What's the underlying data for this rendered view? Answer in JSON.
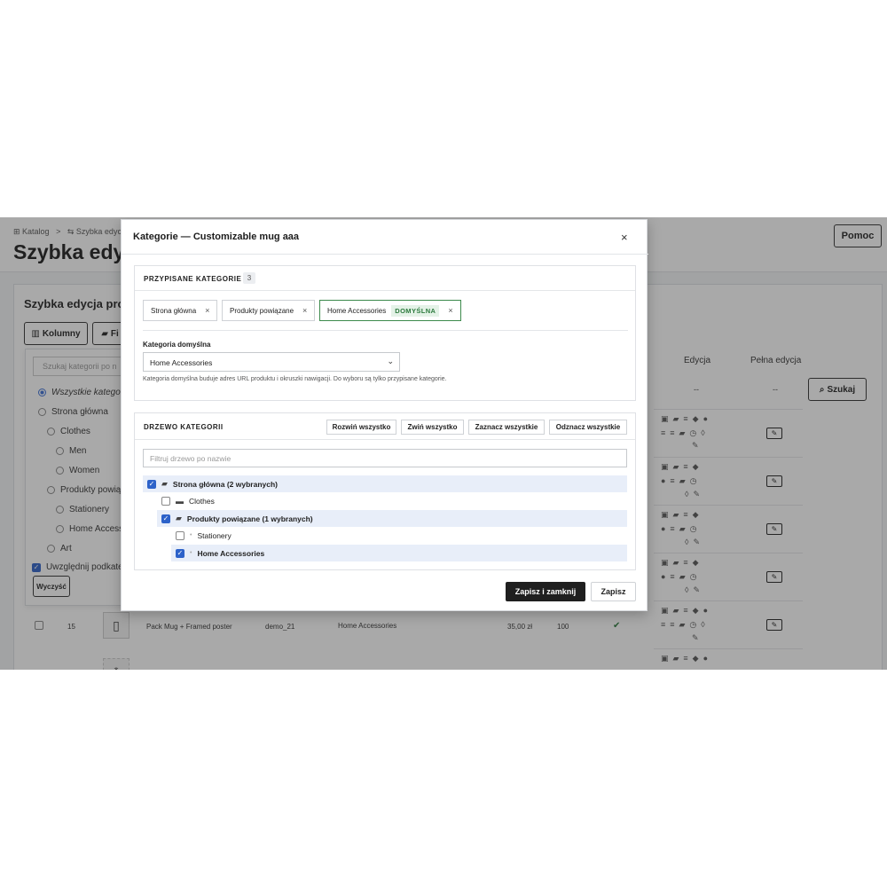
{
  "breadcrumb": {
    "root": "⊞ Katalog",
    "sep": ">",
    "current": "⇆ Szybka edycja"
  },
  "page": {
    "title": "Szybka edycja",
    "help_label": "Pomoc"
  },
  "card": {
    "title": "Szybka edycja prod",
    "columns_label": "Kolumny",
    "filter_label": "Fi",
    "search_label": "Szukaj"
  },
  "filter_panel": {
    "search_placeholder": "Szukaj kategorii po n",
    "items": [
      "Wszystkie kategor",
      "Strona główna",
      "Clothes",
      "Men",
      "Women",
      "Produkty powią",
      "Stationery",
      "Home Access",
      "Art"
    ],
    "include_sub": "Uwzględnij podkate",
    "clear": "Wyczyść"
  },
  "table": {
    "col_edit": "Edycja",
    "col_full_edit": "Pełna edycja",
    "dash": "--",
    "row": {
      "id": "15",
      "name": "Pack Mug + Framed poster",
      "ref": "demo_21",
      "category": "Home Accessories",
      "price": "35,00 zł",
      "qty": "100"
    }
  },
  "modal": {
    "title": "Kategorie — Customizable mug aaa",
    "close": "×",
    "assigned": {
      "title": "PRZYPISANE KATEGORIE",
      "count": "3",
      "tags": [
        {
          "label": "Strona główna"
        },
        {
          "label": "Produkty powiązane"
        },
        {
          "label": "Home Accessories",
          "badge": "DOMYŚLNA"
        }
      ],
      "default_label": "Kategoria domyślna",
      "default_value": "Home Accessories",
      "help": "Kategoria domyślna buduje adres URL produktu i okruszki nawigacji. Do wyboru są tylko przypisane kategorie."
    },
    "tree": {
      "title": "DRZEWO KATEGORII",
      "expand_all": "Rozwiń wszystko",
      "collapse_all": "Zwiń wszystko",
      "select_all": "Zaznacz wszystkie",
      "deselect_all": "Odznacz wszystkie",
      "filter_placeholder": "Filtruj drzewo po nazwie",
      "nodes": [
        {
          "label": "Strona główna (2 wybranych)",
          "checked": true
        },
        {
          "label": "Clothes",
          "checked": false
        },
        {
          "label": "Produkty powiązane (1 wybranych)",
          "checked": true
        },
        {
          "label": "Stationery",
          "checked": false
        },
        {
          "label": "Home Accessories",
          "checked": true
        }
      ]
    },
    "save_close": "Zapisz i zamknij",
    "save": "Zapisz"
  },
  "colors": {
    "accent": "#2d62c9",
    "default_green": "#2c7a3d",
    "primary_dark": "#1f1f1f"
  }
}
